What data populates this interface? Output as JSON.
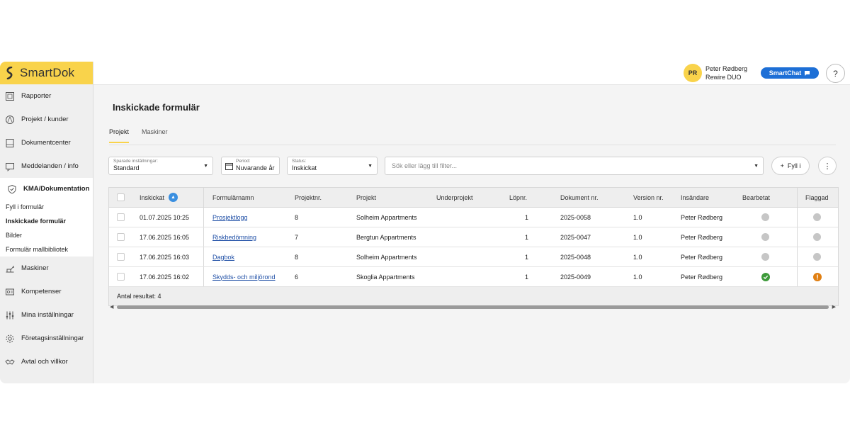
{
  "brand": {
    "name": "SmartDok"
  },
  "sidebar": {
    "items": [
      {
        "label": "Rapporter",
        "icon": "report-icon"
      },
      {
        "label": "Projekt / kunder",
        "icon": "project-icon"
      },
      {
        "label": "Dokumentcenter",
        "icon": "document-icon"
      },
      {
        "label": "Meddelanden / info",
        "icon": "message-icon"
      },
      {
        "label": "KMA/Dokumentation",
        "icon": "shield-check-icon"
      }
    ],
    "sub_items": [
      "Fyll i formulär",
      "Inskickade formulär",
      "Bilder",
      "Formulär mallbibliotek"
    ],
    "items_bottom": [
      {
        "label": "Maskiner",
        "icon": "machine-icon"
      },
      {
        "label": "Kompetenser",
        "icon": "competence-icon"
      },
      {
        "label": "Mina inställningar",
        "icon": "sliders-icon"
      },
      {
        "label": "Företagsinställningar",
        "icon": "gear-icon"
      },
      {
        "label": "Avtal och villkor",
        "icon": "handshake-icon"
      }
    ]
  },
  "header": {
    "avatar_initials": "PR",
    "user_name": "Peter Rødberg",
    "company": "Rewire DUO",
    "smartchat_label": "SmartChat",
    "help_label": "?"
  },
  "page": {
    "title": "Inskickade formulär",
    "tabs": [
      "Projekt",
      "Maskiner"
    ]
  },
  "filters": {
    "saved": {
      "label": "Sparade inställningar:",
      "value": "Standard"
    },
    "period": {
      "label": "Period:",
      "value": "Nuvarande år"
    },
    "status": {
      "label": "Status:",
      "value": "Inskickat"
    },
    "search_placeholder": "Sök eller lägg till filter...",
    "fill_label": "Fyll i"
  },
  "table": {
    "columns": [
      "Inskickat",
      "Formulärnamn",
      "Projektnr.",
      "Projekt",
      "Underprojekt",
      "Löpnr.",
      "Dokument nr.",
      "Version nr.",
      "Insändare",
      "Bearbetat",
      "Flaggad"
    ],
    "rows": [
      {
        "inskickat": "01.07.2025 10:25",
        "formular": "Prosjektlogg",
        "projektnr": "8",
        "projekt": "Solheim Appartments",
        "underprojekt": "",
        "lopnr": "1",
        "dokument": "2025-0058",
        "version": "1.0",
        "insandare": "Peter Rødberg",
        "bearbetat": "gray",
        "flaggad": "gray"
      },
      {
        "inskickat": "17.06.2025 16:05",
        "formular": "Riskbedömning",
        "projektnr": "7",
        "projekt": "Bergtun Appartments",
        "underprojekt": "",
        "lopnr": "1",
        "dokument": "2025-0047",
        "version": "1.0",
        "insandare": "Peter Rødberg",
        "bearbetat": "gray",
        "flaggad": "gray"
      },
      {
        "inskickat": "17.06.2025 16:03",
        "formular": "Dagbok",
        "projektnr": "8",
        "projekt": "Solheim Appartments",
        "underprojekt": "",
        "lopnr": "1",
        "dokument": "2025-0048",
        "version": "1.0",
        "insandare": "Peter Rødberg",
        "bearbetat": "gray",
        "flaggad": "gray"
      },
      {
        "inskickat": "17.06.2025 16:02",
        "formular": "Skydds- och miljörond",
        "projektnr": "6",
        "projekt": "Skoglia Appartments",
        "underprojekt": "",
        "lopnr": "1",
        "dokument": "2025-0049",
        "version": "1.0",
        "insandare": "Peter Rødberg",
        "bearbetat": "green-check",
        "flaggad": "orange-alert"
      }
    ],
    "footer": "Antal resultat: 4"
  },
  "colors": {
    "brand_yellow": "#f9d34b",
    "link_blue": "#1f4fa6",
    "accent_blue": "#1d6fd6",
    "status_gray": "#c6c6c6",
    "status_green": "#3e9a3a",
    "status_orange": "#e07f12"
  }
}
